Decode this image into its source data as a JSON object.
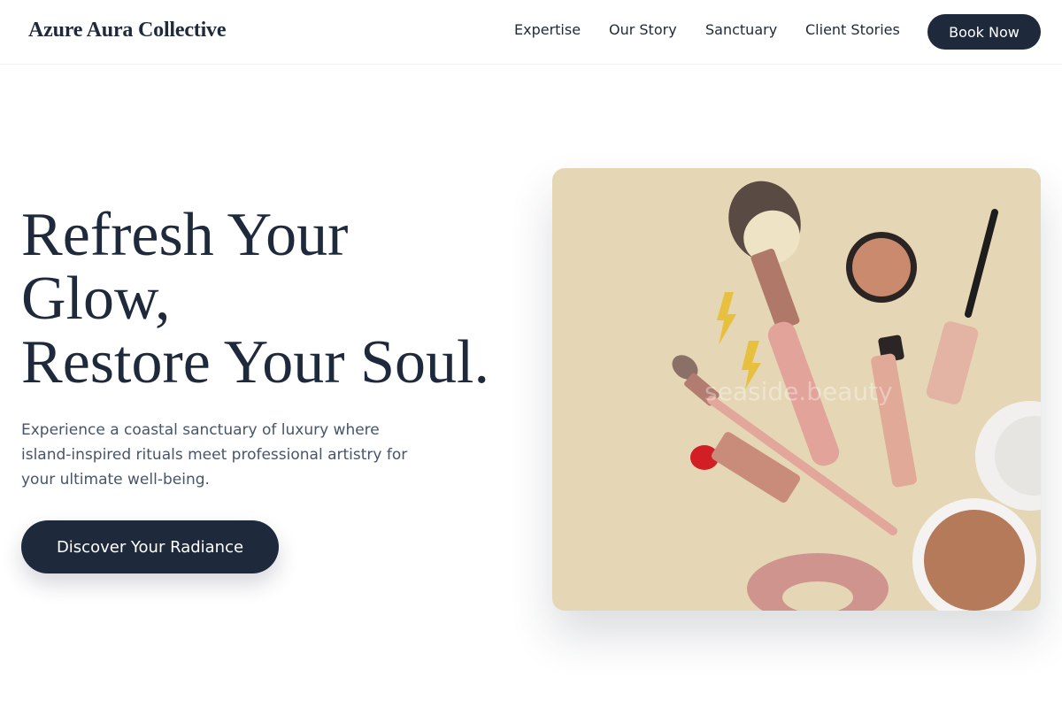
{
  "header": {
    "brand": "Azure Aura Collective",
    "nav": [
      "Expertise",
      "Our Story",
      "Sanctuary",
      "Client Stories"
    ],
    "book_label": "Book Now"
  },
  "hero": {
    "headline_lines": [
      "Refresh Your",
      "Glow,",
      "Restore Your Soul."
    ],
    "subtext": "Experience a coastal sanctuary of luxury where island-inspired rituals meet professional artistry for your ultimate well-being.",
    "cta_label": "Discover Your Radiance",
    "image_watermark": "seaside.beauty"
  },
  "colors": {
    "primary": "#1e293b",
    "muted_text": "#475569",
    "image_background": "#e5d7b5"
  }
}
